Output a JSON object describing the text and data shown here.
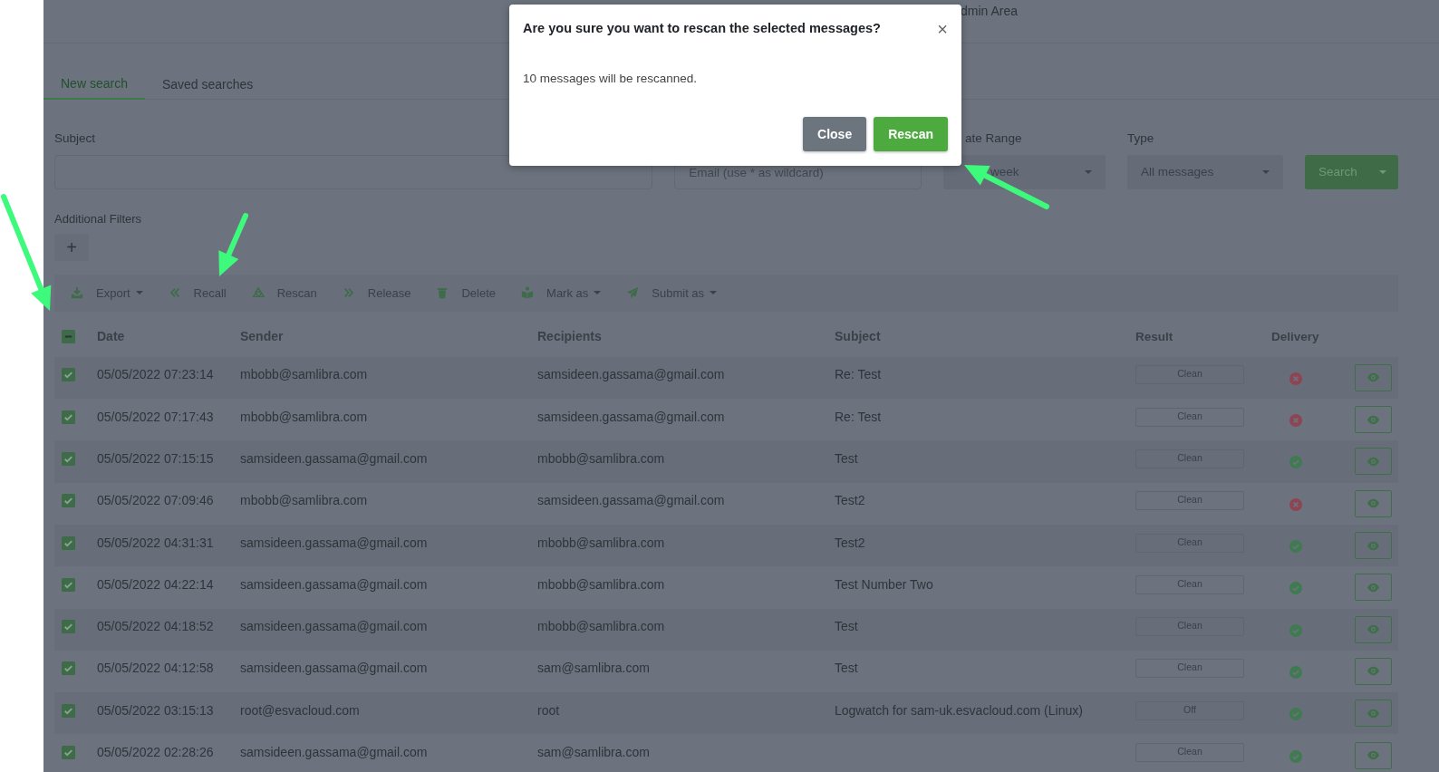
{
  "header": {
    "nav_fragment": "dmin Area"
  },
  "tabs": [
    {
      "label": "New search",
      "selected": true
    },
    {
      "label": "Saved searches",
      "selected": false
    }
  ],
  "filters": {
    "subject": {
      "label": "Subject"
    },
    "email": {
      "placeholder": "Email (use * as wildcard)"
    },
    "date_range": {
      "label": "ate Range",
      "value": "week"
    },
    "type": {
      "label": "Type",
      "value": "All messages"
    },
    "search_button": "Search"
  },
  "additional_filters": {
    "label": "Additional Filters",
    "add_button": "+"
  },
  "toolbar": [
    {
      "label": "Export",
      "kind": "download",
      "dropdown": true
    },
    {
      "label": "Recall",
      "kind": "back",
      "dropdown": false
    },
    {
      "label": "Rescan",
      "kind": "recycle",
      "dropdown": false
    },
    {
      "label": "Release",
      "kind": "forward",
      "dropdown": false
    },
    {
      "label": "Delete",
      "kind": "trash",
      "dropdown": false
    },
    {
      "label": "Mark as",
      "kind": "reader",
      "dropdown": true
    },
    {
      "label": "Submit as",
      "kind": "send",
      "dropdown": true
    }
  ],
  "table": {
    "select_all": {
      "indeterminate": true
    },
    "columns": [
      "Date",
      "Sender",
      "Recipients",
      "Subject",
      "Result",
      "Delivery"
    ],
    "rows": [
      {
        "checked": true,
        "date": "05/05/2022 07:23:14",
        "sender": "mbobb@samlibra.com",
        "recipients": "samsideen.gassama@gmail.com",
        "subject": "Re: Test",
        "result": "Clean",
        "delivered": false
      },
      {
        "checked": true,
        "date": "05/05/2022 07:17:43",
        "sender": "mbobb@samlibra.com",
        "recipients": "samsideen.gassama@gmail.com",
        "subject": "Re: Test",
        "result": "Clean",
        "delivered": false
      },
      {
        "checked": true,
        "date": "05/05/2022 07:15:15",
        "sender": "samsideen.gassama@gmail.com",
        "recipients": "mbobb@samlibra.com",
        "subject": "Test",
        "result": "Clean",
        "delivered": true
      },
      {
        "checked": true,
        "date": "05/05/2022 07:09:46",
        "sender": "mbobb@samlibra.com",
        "recipients": "samsideen.gassama@gmail.com",
        "subject": "Test2",
        "result": "Clean",
        "delivered": false
      },
      {
        "checked": true,
        "date": "05/05/2022 04:31:31",
        "sender": "samsideen.gassama@gmail.com",
        "recipients": "mbobb@samlibra.com",
        "subject": "Test2",
        "result": "Clean",
        "delivered": true
      },
      {
        "checked": true,
        "date": "05/05/2022 04:22:14",
        "sender": "samsideen.gassama@gmail.com",
        "recipients": "mbobb@samlibra.com",
        "subject": "Test Number Two",
        "result": "Clean",
        "delivered": true
      },
      {
        "checked": true,
        "date": "05/05/2022 04:18:52",
        "sender": "samsideen.gassama@gmail.com",
        "recipients": "mbobb@samlibra.com",
        "subject": "Test",
        "result": "Clean",
        "delivered": true
      },
      {
        "checked": true,
        "date": "05/05/2022 04:12:58",
        "sender": "samsideen.gassama@gmail.com",
        "recipients": "sam@samlibra.com",
        "subject": "Test",
        "result": "Clean",
        "delivered": true
      },
      {
        "checked": true,
        "date": "05/05/2022 03:15:13",
        "sender": "root@esvacloud.com",
        "recipients": "root",
        "subject": "Logwatch for sam-uk.esvacloud.com (Linux)",
        "result": "Off",
        "delivered": true
      },
      {
        "checked": true,
        "date": "05/05/2022 02:28:26",
        "sender": "samsideen.gassama@gmail.com",
        "recipients": "sam@samlibra.com",
        "result": "Clean",
        "delivered": true
      }
    ]
  },
  "modal": {
    "title": "Are you sure you want to rescan the selected messages?",
    "close_icon": "×",
    "body": "10 messages will be rescanned.",
    "buttons": [
      {
        "label": "Close",
        "kind": "secondary"
      },
      {
        "label": "Rescan",
        "kind": "primary"
      }
    ]
  }
}
